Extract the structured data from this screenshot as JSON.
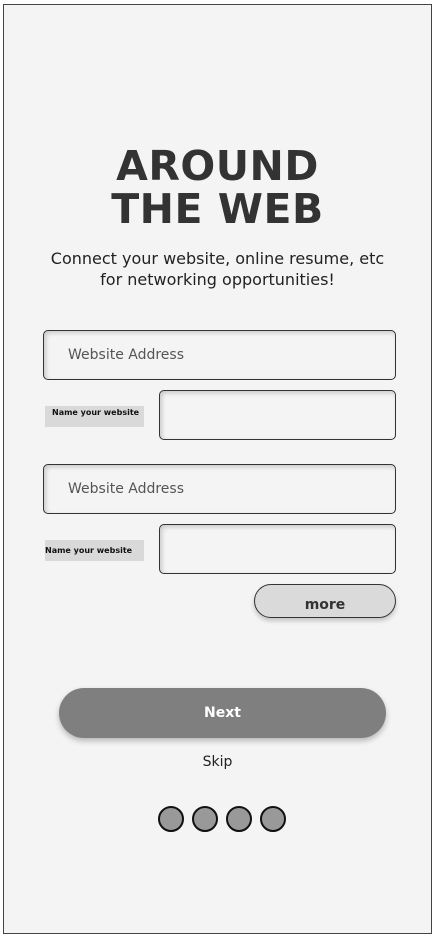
{
  "header": {
    "title_line1": "AROUND",
    "title_line2": "THE WEB",
    "subtitle": "Connect your website, online resume, etc for networking opportunities!"
  },
  "websites": [
    {
      "address_placeholder": "Website Address",
      "name_label": "Name your website",
      "name_value": ""
    },
    {
      "address_placeholder": "Website Address",
      "name_label": "Name your website",
      "name_value": ""
    }
  ],
  "actions": {
    "more_label": "more",
    "next_label": "Next",
    "skip_label": "Skip"
  },
  "pagination": {
    "dot_count": 4
  },
  "colors": {
    "background": "#f4f4f4",
    "next_button": "#7f7f7f",
    "more_button": "#dadada",
    "dot_fill": "#999999",
    "title_text": "#333333"
  }
}
